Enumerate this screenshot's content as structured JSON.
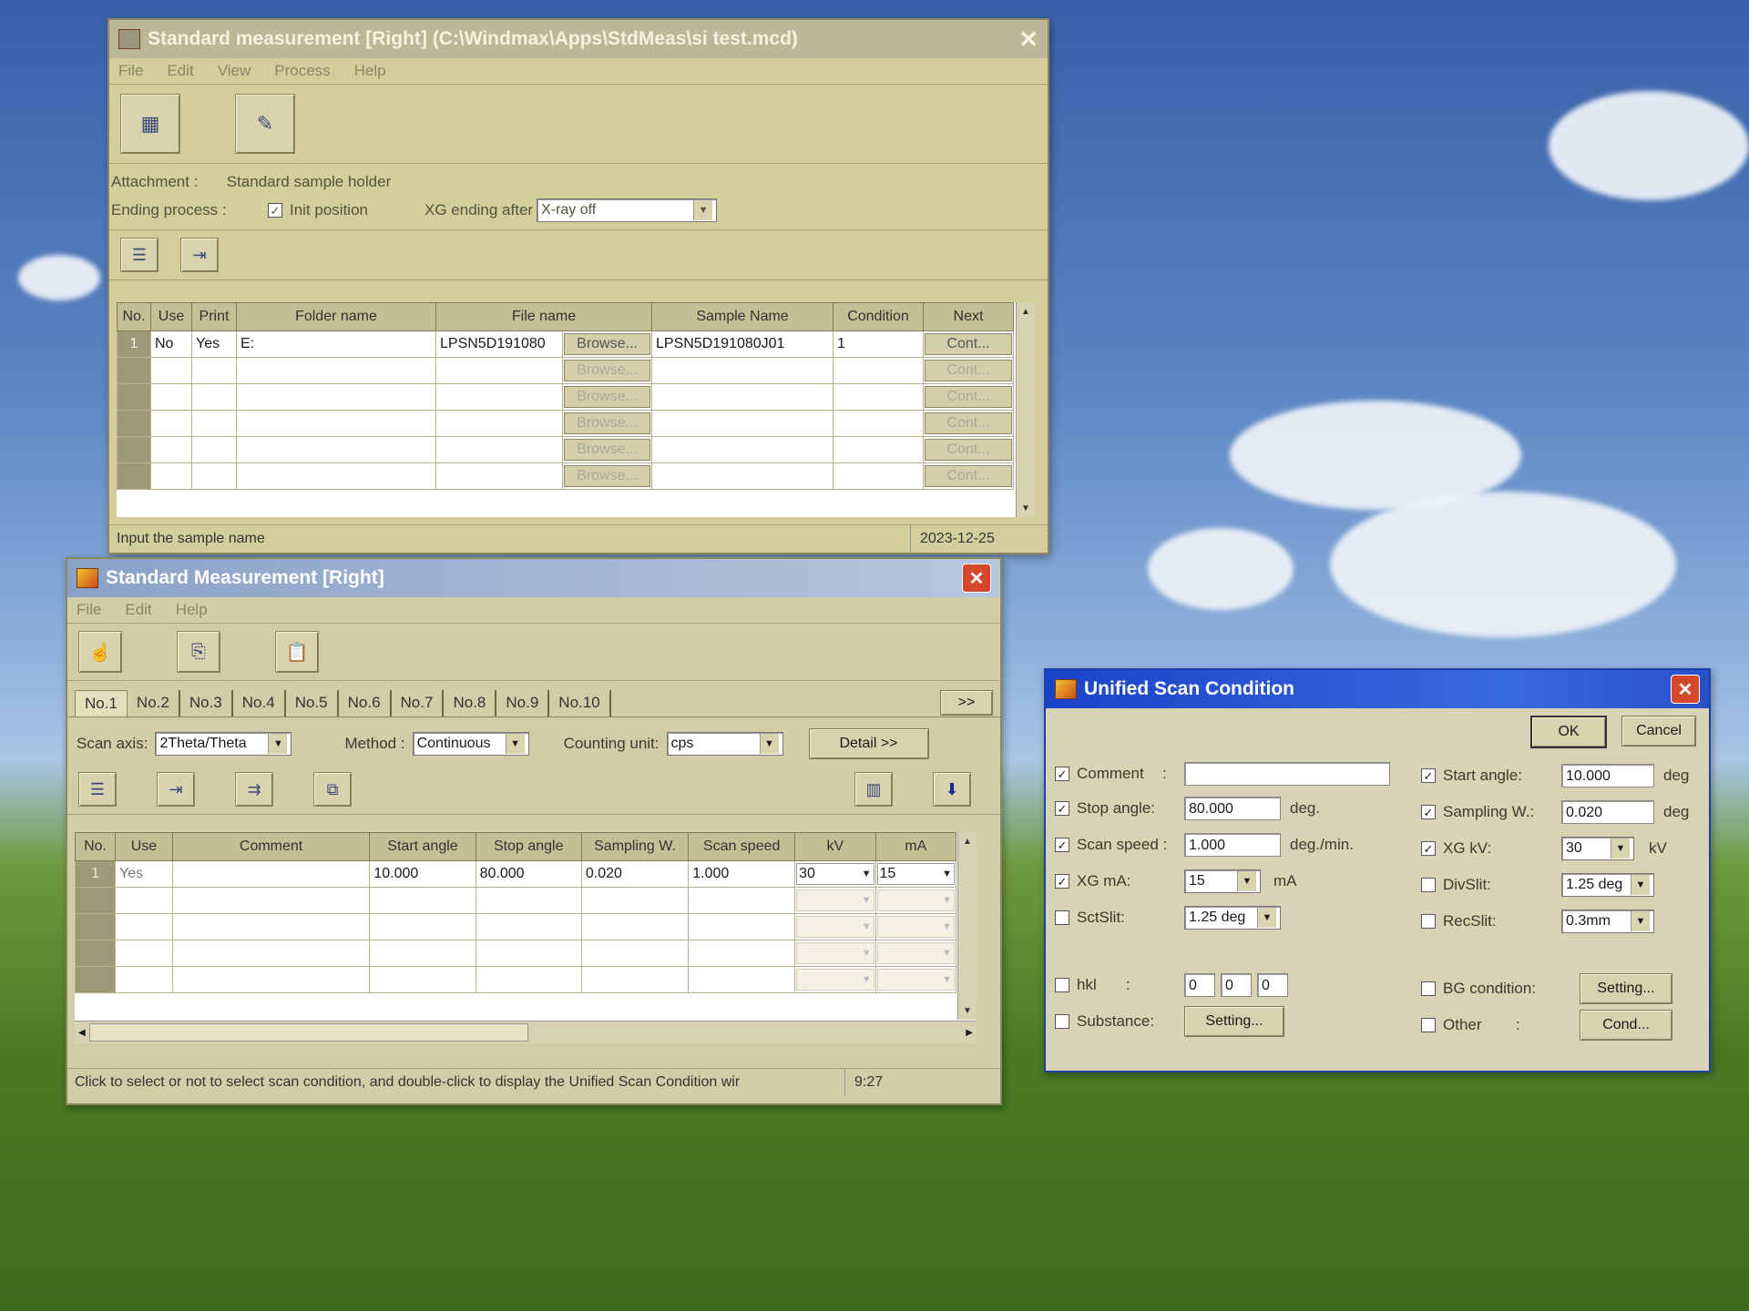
{
  "window1": {
    "title": "Standard measurement [Right] (C:\\Windmax\\Apps\\StdMeas\\si   test.mcd)",
    "menu": [
      "File",
      "Edit",
      "View",
      "Process",
      "Help"
    ],
    "attachment_label": "Attachment :",
    "attachment_value": "Standard sample holder",
    "ending_label": "Ending process :",
    "init_position_label": "Init position",
    "xg_ending_label": "XG ending after",
    "xg_ending_value": "X-ray off",
    "columns": [
      "No.",
      "Use",
      "Print",
      "Folder name",
      "File name",
      "",
      "Sample Name",
      "Condition",
      "Next"
    ],
    "rows": [
      {
        "no": "1",
        "use": "No",
        "print": "Yes",
        "folder": "E:",
        "file": "LPSN5D191080",
        "browse": "Browse...",
        "sample": "LPSN5D191080J01",
        "condition": "1",
        "next": "Cont..."
      },
      {
        "no": "",
        "use": "",
        "print": "",
        "folder": "",
        "file": "",
        "browse": "Browse...",
        "sample": "",
        "condition": "",
        "next": "Cont..."
      },
      {
        "no": "",
        "use": "",
        "print": "",
        "folder": "",
        "file": "",
        "browse": "Browse...",
        "sample": "",
        "condition": "",
        "next": "Cont..."
      },
      {
        "no": "",
        "use": "",
        "print": "",
        "folder": "",
        "file": "",
        "browse": "Browse...",
        "sample": "",
        "condition": "",
        "next": "Cont..."
      },
      {
        "no": "",
        "use": "",
        "print": "",
        "folder": "",
        "file": "",
        "browse": "Browse...",
        "sample": "",
        "condition": "",
        "next": "Cont..."
      },
      {
        "no": "",
        "use": "",
        "print": "",
        "folder": "",
        "file": "",
        "browse": "Browse...",
        "sample": "",
        "condition": "",
        "next": "Cont..."
      }
    ],
    "status_text": "Input the sample name",
    "status_date": "2023-12-25"
  },
  "window2": {
    "title": "Standard Measurement [Right]",
    "menu": [
      "File",
      "Edit",
      "Help"
    ],
    "tabs": [
      "No.1",
      "No.2",
      "No.3",
      "No.4",
      "No.5",
      "No.6",
      "No.7",
      "No.8",
      "No.9",
      "No.10"
    ],
    "more_tabs": ">>",
    "scan_axis_label": "Scan axis:",
    "scan_axis_value": "2Theta/Theta",
    "method_label": "Method :",
    "method_value": "Continuous",
    "counting_label": "Counting unit:",
    "counting_value": "cps",
    "detail_button": "Detail >>",
    "columns": [
      "No.",
      "Use",
      "Comment",
      "Start angle",
      "Stop angle",
      "Sampling W.",
      "Scan speed",
      "kV",
      "mA"
    ],
    "rows": [
      {
        "no": "1",
        "use": "Yes",
        "comment": "",
        "start": "10.000",
        "stop": "80.000",
        "sampling": "0.020",
        "speed": "1.000",
        "kv": "30",
        "ma": "15"
      }
    ],
    "status_text": "Click to select or not to select scan condition, and double-click to display the Unified Scan Condition wir",
    "status_time": "9:27"
  },
  "dialog": {
    "title": "Unified Scan Condition",
    "ok": "OK",
    "cancel": "Cancel",
    "comment_label": "Comment",
    "comment_colon": ":",
    "comment_value": "",
    "stop_angle_label": "Stop angle:",
    "stop_angle_value": "80.000",
    "stop_angle_unit": "deg.",
    "scan_speed_label": "Scan speed :",
    "scan_speed_value": "1.000",
    "scan_speed_unit": "deg./min.",
    "xg_ma_label": "XG mA:",
    "xg_ma_value": "15",
    "xg_ma_unit": "mA",
    "sctslit_label": "SctSlit:",
    "sctslit_value": "1.25 deg",
    "hkl_label": "hkl",
    "hkl_colon": ":",
    "hkl_values": [
      "0",
      "0",
      "0"
    ],
    "substance_label": "Substance:",
    "substance_button": "Setting...",
    "start_angle_label": "Start angle:",
    "start_angle_value": "10.000",
    "start_angle_unit": "deg",
    "sampling_label": "Sampling W.:",
    "sampling_value": "0.020",
    "sampling_unit": "deg",
    "xg_kv_label": "XG kV:",
    "xg_kv_value": "30",
    "xg_kv_unit": "kV",
    "divslit_label": "DivSlit:",
    "divslit_value": "1.25 deg",
    "recslit_label": "RecSlit:",
    "recslit_value": "0.3mm",
    "bg_label": "BG condition:",
    "bg_button": "Setting...",
    "other_label": "Other",
    "other_colon": ":",
    "other_button": "Cond..."
  },
  "colors": {
    "title_active": "#1c4fd0",
    "title_inactive": "#b9b7a0",
    "window_face": "#cfc9a0",
    "close_red": "#d6482c"
  }
}
